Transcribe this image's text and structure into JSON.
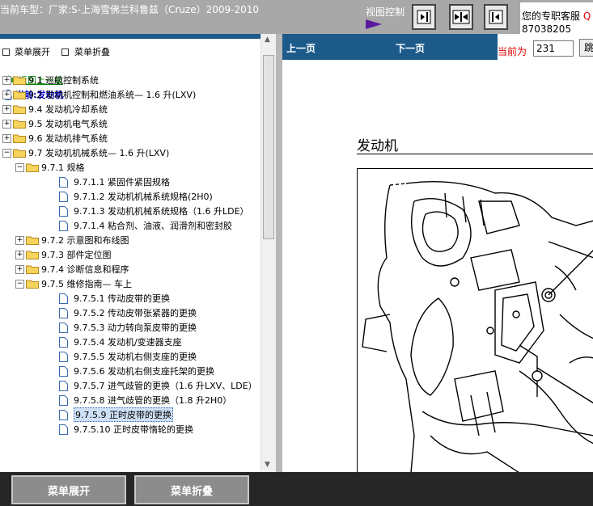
{
  "header": {
    "car_model": "当前车型：厂家:S-上海雪佛兰科鲁兹（Cruze）2009-2010",
    "view_control_label": "视图控制",
    "support_text": "您的专职客服",
    "support_accent": "Q",
    "support_number": "87038205"
  },
  "left_panel": {
    "expand_label": "菜单展开",
    "collapse_label": "菜单折叠",
    "back_label": "返回上一级",
    "current_label": "当前:发动机",
    "tree": [
      {
        "label": "9.1 巡航控制系统",
        "type": "folder"
      },
      {
        "label": "9.2 发动机控制和燃油系统— 1.6 升(LXV)",
        "type": "folder"
      },
      {
        "label": "9.4 发动机冷却系统",
        "type": "folder"
      },
      {
        "label": "9.5 发动机电气系统",
        "type": "folder"
      },
      {
        "label": "9.6 发动机排气系统",
        "type": "folder"
      },
      {
        "label": "9.7 发动机机械系统— 1.6 升(LXV)",
        "type": "folder-open"
      },
      {
        "label": "9.7.1 规格",
        "type": "folder-open"
      },
      {
        "label": "9.7.1.1 紧固件紧固规格",
        "type": "doc"
      },
      {
        "label": "9.7.1.2 发动机机械系统规格(2H0)",
        "type": "doc"
      },
      {
        "label": "9.7.1.3 发动机机械系统规格（1.6 升LDE）",
        "type": "doc"
      },
      {
        "label": "9.7.1.4 粘合剂、油液、润滑剂和密封胶",
        "type": "doc"
      },
      {
        "label": "9.7.2 示意图和布线图",
        "type": "folder"
      },
      {
        "label": "9.7.3 部件定位图",
        "type": "folder"
      },
      {
        "label": "9.7.4 诊断信息和程序",
        "type": "folder"
      },
      {
        "label": "9.7.5 维修指南— 车上",
        "type": "folder-open"
      },
      {
        "label": "9.7.5.1 传动皮带的更换",
        "type": "doc"
      },
      {
        "label": "9.7.5.2 传动皮带张紧器的更换",
        "type": "doc"
      },
      {
        "label": "9.7.5.3 动力转向泵皮带的更换",
        "type": "doc"
      },
      {
        "label": "9.7.5.4 发动机/变速器支座",
        "type": "doc"
      },
      {
        "label": "9.7.5.5 发动机右侧支座的更换",
        "type": "doc"
      },
      {
        "label": "9.7.5.6 发动机右侧支座托架的更换",
        "type": "doc"
      },
      {
        "label": "9.7.5.7 进气歧管的更换（1.6 升LXV、LDE）",
        "type": "doc"
      },
      {
        "label": "9.7.5.8 进气歧管的更换（1.8 升2H0）",
        "type": "doc"
      },
      {
        "label": "9.7.5.9 正时皮带的更换",
        "type": "doc",
        "selected": true
      },
      {
        "label": "9.7.5.10 正时皮带惰轮的更换",
        "type": "doc"
      }
    ]
  },
  "content": {
    "prev_label": "上一页",
    "next_label": "下一页",
    "current_page_label": "当前为",
    "page_number": "231",
    "jump_label": "跳",
    "doc_title": "发动机"
  },
  "bottom": {
    "expand_button": "菜单展开",
    "collapse_button": "菜单折叠"
  },
  "colors": {
    "nav_blue": "#1c5a8a",
    "highlight_red": "#e00000",
    "back_green": "#008000",
    "current_blue": "#0000cc",
    "selected_bg": "#cfe1f6"
  }
}
